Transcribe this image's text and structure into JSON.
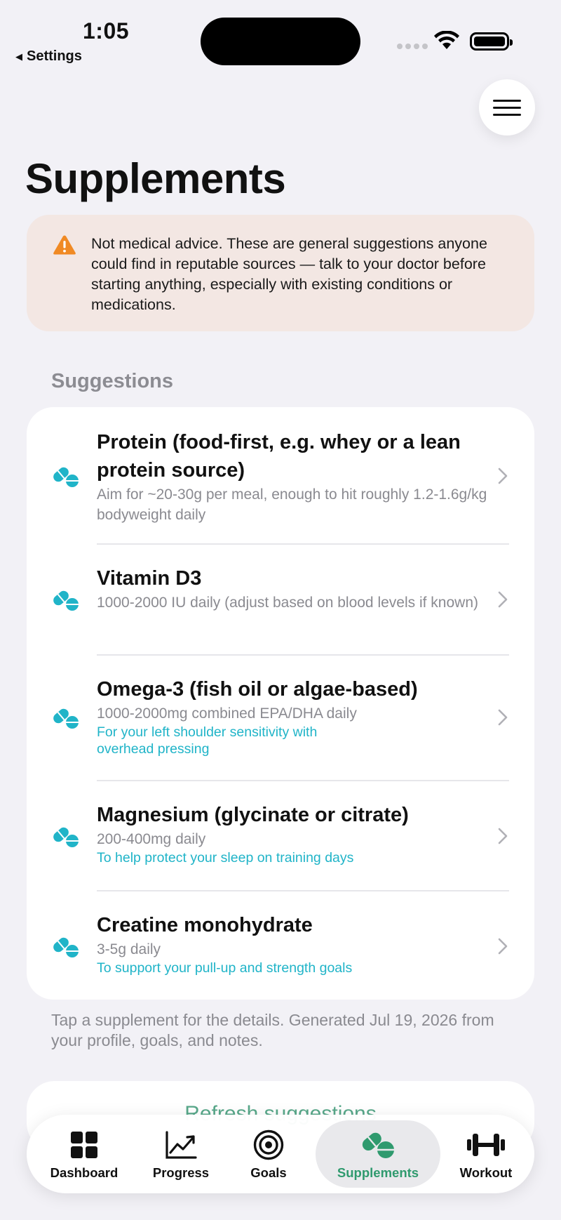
{
  "status_bar": {
    "time": "1:05",
    "back_label": "Settings"
  },
  "page": {
    "title": "Supplements"
  },
  "warning": {
    "text": "Not medical advice. These are general suggestions anyone could find in reputable sources — talk to your doctor before starting anything, especially with existing conditions or medications."
  },
  "suggestions": {
    "section_label": "Suggestions",
    "items": [
      {
        "name": "Protein (food-first, e.g. whey or a lean protein source)",
        "dose": "Aim for ~20-30g per meal, enough to hit roughly 1.2-1.6g/kg bodyweight daily",
        "reason": ""
      },
      {
        "name": "Vitamin D3",
        "dose": "1000-2000 IU daily (adjust based on blood levels if known)",
        "reason": ""
      },
      {
        "name": "Omega-3 (fish oil or algae-based)",
        "dose": "1000-2000mg combined EPA/DHA daily",
        "reason": "For your left shoulder sensitivity with overhead pressing"
      },
      {
        "name": "Magnesium (glycinate or citrate)",
        "dose": "200-400mg daily",
        "reason": "To help protect your sleep on training days"
      },
      {
        "name": "Creatine monohydrate",
        "dose": "3-5g daily",
        "reason": "To support your pull-up and strength goals"
      }
    ]
  },
  "footer_note": "Tap a supplement for the details. Generated Jul 19, 2026 from your profile, goals, and notes.",
  "refresh_button": {
    "label": "Refresh suggestions"
  },
  "tabbar": {
    "active": "Supplements",
    "tabs": [
      {
        "label": "Dashboard",
        "icon": "grid-icon"
      },
      {
        "label": "Progress",
        "icon": "chart-trend-icon"
      },
      {
        "label": "Goals",
        "icon": "target-icon"
      },
      {
        "label": "Supplements",
        "icon": "pills-icon"
      },
      {
        "label": "Workout",
        "icon": "dumbbell-icon"
      }
    ]
  },
  "colors": {
    "accent_teal": "#20b4c8",
    "accent_green": "#2f9a6e",
    "warning_orange": "#f08a24",
    "warning_bg": "#f3e7e3"
  }
}
